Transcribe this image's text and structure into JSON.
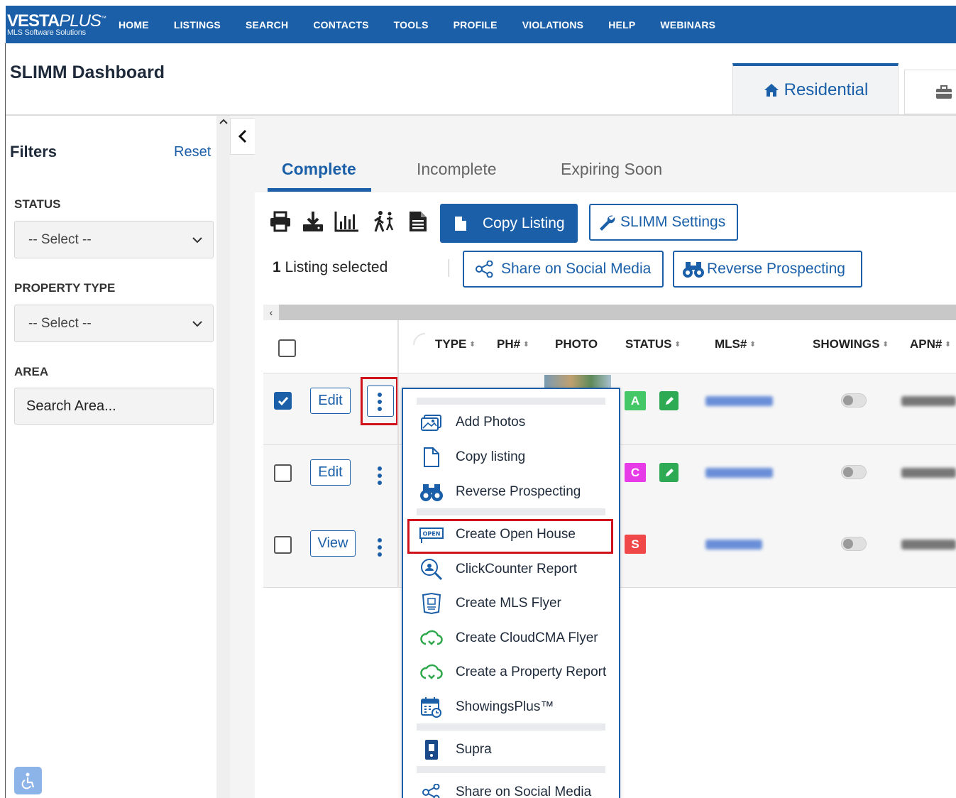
{
  "nav": {
    "logo_main": "VESTA",
    "logo_plus": "PLUS",
    "logo_tm": "™",
    "logo_sub": "MLS Software Solutions",
    "items": [
      "HOME",
      "LISTINGS",
      "SEARCH",
      "CONTACTS",
      "TOOLS",
      "PROFILE",
      "VIOLATIONS",
      "HELP",
      "WEBINARS"
    ]
  },
  "header": {
    "title": "SLIMM Dashboard",
    "tab_residential": "Residential"
  },
  "filters": {
    "title": "Filters",
    "reset": "Reset",
    "status_label": "STATUS",
    "status_value": "-- Select --",
    "property_type_label": "PROPERTY TYPE",
    "property_type_value": "-- Select --",
    "area_label": "AREA",
    "area_placeholder": "Search Area..."
  },
  "main_tabs": [
    "Complete",
    "Incomplete",
    "Expiring Soon"
  ],
  "toolbar": {
    "copy_listing": "Copy Listing",
    "slimm_settings": "SLIMM Settings",
    "listing_count": "1",
    "listing_selected": " Listing selected",
    "share_social": "Share on Social Media",
    "reverse_prospecting": "Reverse Prospecting"
  },
  "table": {
    "headers": [
      "TYPE",
      "PH#",
      "PHOTO",
      "STATUS",
      "MLS#",
      "SHOWINGS",
      "APN#"
    ],
    "rows": [
      {
        "action": "Edit",
        "checked": true,
        "status": "A",
        "status_color": "#44c767"
      },
      {
        "action": "Edit",
        "checked": false,
        "status": "C",
        "status_color": "#e83be8"
      },
      {
        "action": "View",
        "checked": false,
        "status": "S",
        "status_color": "#f04848"
      }
    ]
  },
  "menu": {
    "items": [
      "Add Photos",
      "Copy listing",
      "Reverse Prospecting",
      "Create Open House",
      "ClickCounter Report",
      "Create MLS Flyer",
      "Create CloudCMA Flyer",
      "Create a Property Report",
      "ShowingsPlus™",
      "Supra",
      "Share on Social Media"
    ]
  },
  "colors": {
    "brand_blue": "#1a5fa8",
    "highlight_red": "#d0121c"
  }
}
